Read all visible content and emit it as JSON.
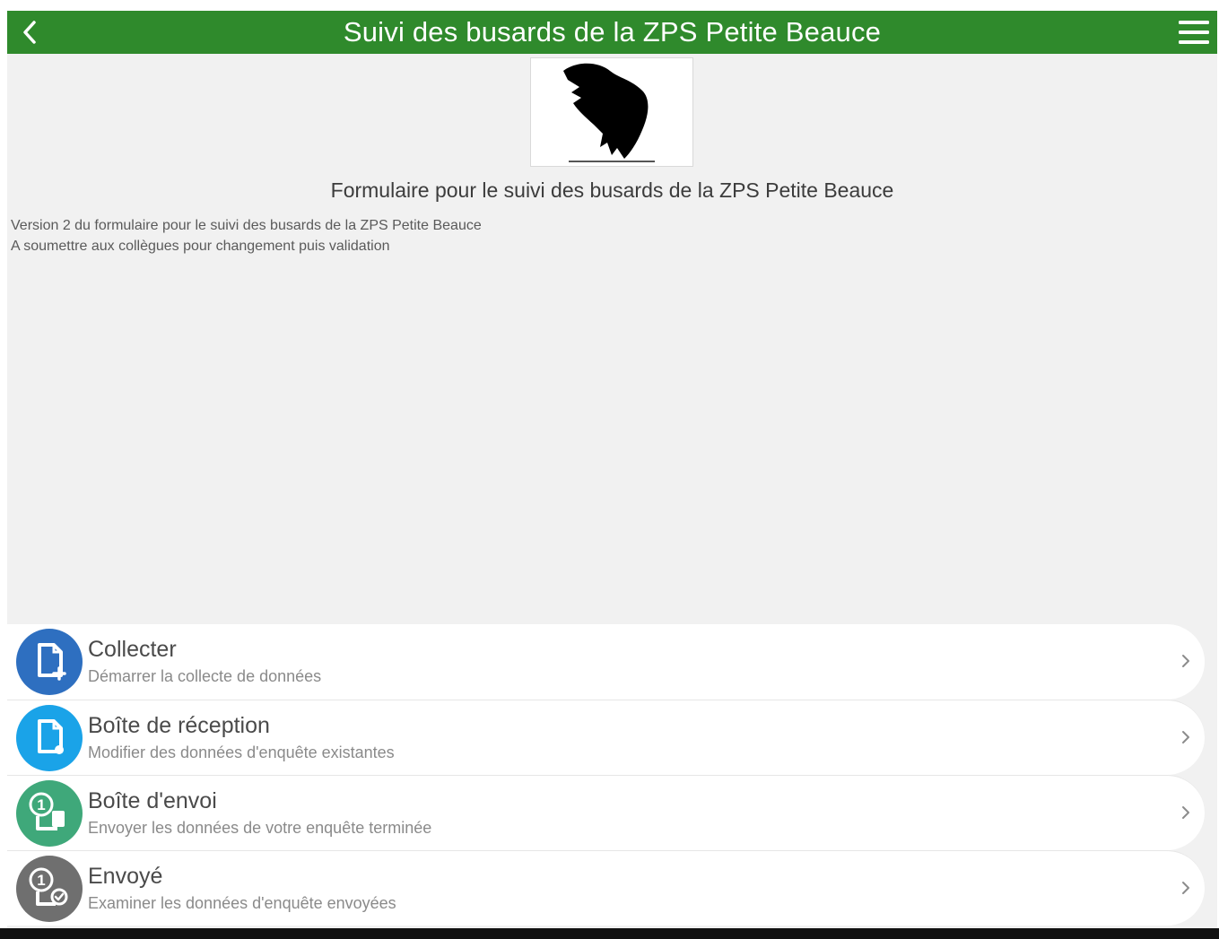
{
  "header": {
    "title": "Suivi des busards de la ZPS Petite Beauce",
    "color": "#2f8a2c",
    "back_icon": "chevron-left-icon",
    "menu_icon": "hamburger-menu-icon"
  },
  "form": {
    "title": "Formulaire pour le suivi des busards de la ZPS Petite Beauce",
    "description_line1": "Version 2 du formulaire pour le suivi des busards de la ZPS Petite Beauce",
    "description_line2": "A soumettre aux collègues pour changement puis validation",
    "thumbnail_icon": "raptor-silhouette-icon"
  },
  "menu": {
    "items": [
      {
        "title": "Collecter",
        "subtitle": "Démarrer la collecte de données",
        "icon": "collect-form-icon",
        "color": "#2e6fc0"
      },
      {
        "title": "Boîte de réception",
        "subtitle": "Modifier des données d'enquête existantes",
        "icon": "inbox-form-icon",
        "color": "#1aa3e8"
      },
      {
        "title": "Boîte d'envoi",
        "subtitle": "Envoyer les données de votre enquête terminée",
        "icon": "outbox-form-icon",
        "color": "#3fa87a",
        "badge": "1"
      },
      {
        "title": "Envoyé",
        "subtitle": "Examiner les données d'enquête envoyées",
        "icon": "sent-form-icon",
        "color": "#6f6f6f",
        "badge": "1"
      }
    ]
  }
}
